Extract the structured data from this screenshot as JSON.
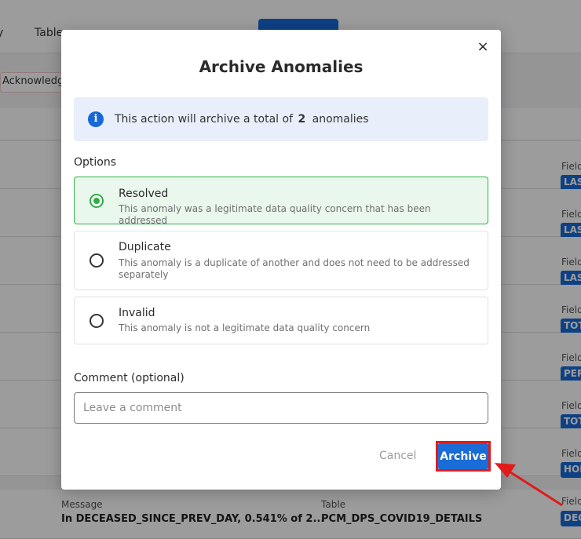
{
  "background": {
    "nav_tab_partial": "y",
    "nav_tab_table": "Table",
    "acknowledge_chip": "Acknowledg",
    "field_label": "Field",
    "row_tags": [
      "LAS",
      "LAS",
      "LAS",
      "TOT",
      "PER",
      "TOT",
      "HOI",
      "DEC"
    ],
    "last_row": {
      "message_label": "Message",
      "message_value": "In DECEASED_SINCE_PREV_DAY, 0.541% of 2...",
      "table_label": "Table",
      "table_value": "PCM_DPS_COVID19_DETAILS"
    }
  },
  "modal": {
    "title": "Archive Anomalies",
    "close_glyph": "×",
    "info": {
      "text_before": "This action will archive a total of",
      "count": "2",
      "text_after": "anomalies",
      "icon_glyph": "i"
    },
    "options_label": "Options",
    "options": [
      {
        "title": "Resolved",
        "description": "This anomaly was a legitimate data quality concern that has been addressed",
        "selected": true
      },
      {
        "title": "Duplicate",
        "description": "This anomaly is a duplicate of another and does not need to be addressed separately",
        "selected": false
      },
      {
        "title": "Invalid",
        "description": "This anomaly is not a legitimate data quality concern",
        "selected": false
      }
    ],
    "comment_label": "Comment (optional)",
    "comment_placeholder": "Leave a comment",
    "comment_value": "",
    "cancel_label": "Cancel",
    "archive_label": "Archive"
  },
  "colors": {
    "primary": "#1a6cd6",
    "selected_green": "#2eae46",
    "highlight_red": "#e21a1a"
  }
}
